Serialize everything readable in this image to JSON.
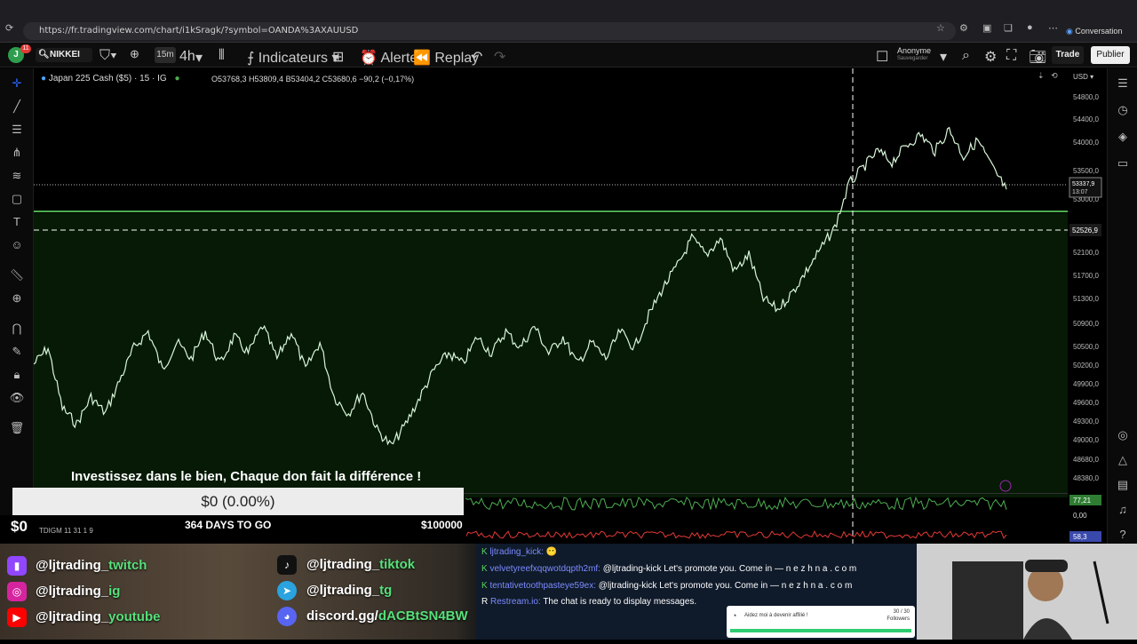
{
  "browser": {
    "url": "https://fr.tradingview.com/chart/i1kSragk/?symbol=OANDA%3AXAUUSD",
    "conversation_label": "Conversation"
  },
  "toolbar": {
    "avatar_letter": "J",
    "notif_count": "11",
    "symbol": "NIKKEI",
    "tf_15": "15m",
    "tf_4h": "4h",
    "indicators": "Indicateurs",
    "alert": "Alerte",
    "replay": "Replay",
    "account": "Anonyme",
    "save": "Sauvegarder",
    "trade": "Trade",
    "publish": "Publier"
  },
  "chart": {
    "legend": "Japan 225 Cash ($5) · 15 · IG",
    "ohlc": "O53768,3 H53809,4 B53404,2 C53680,6 −90,2 (−0,17%)",
    "currency": "USD",
    "price_labels": [
      "54800,0",
      "54400,0",
      "54000,0",
      "53500,0",
      "53000,0",
      "52100,0",
      "51700,0",
      "51300,0",
      "50900,0",
      "50500,0",
      "50200,0",
      "49900,0",
      "49600,0",
      "49300,0",
      "49000,0",
      "48680,0",
      "48380,0"
    ],
    "current_price": "53337,9",
    "countdown": "13:07",
    "crosshair_price": "52526,9",
    "osc_value": "77,21",
    "osc_zero": "0,00",
    "osc_value2": "58,3",
    "colors": {
      "accent": "#4caf50",
      "price_line": "#ffffff",
      "background": "#000000"
    }
  },
  "chart_data": {
    "type": "line",
    "title": "Japan 225 Cash ($5) · 15 · IG",
    "ylim": [
      48380,
      54800
    ],
    "y": [
      50200,
      50500,
      49400,
      49100,
      49600,
      49300,
      49900,
      50500,
      50800,
      50100,
      50600,
      50300,
      50800,
      50200,
      50700,
      50400,
      50900,
      50300,
      50800,
      50100,
      50600,
      49600,
      49300,
      49700,
      49000,
      48700,
      49100,
      49600,
      50100,
      50400,
      50200,
      50700,
      50400,
      50800,
      50500,
      50900,
      50400,
      50700,
      50200,
      50600,
      50300,
      50800,
      50500,
      51100,
      51600,
      52000,
      52500,
      52200,
      52500,
      51900,
      52200,
      51400,
      51200,
      51500,
      51900,
      52300,
      52700,
      53500,
      53800,
      54100,
      53900,
      54200,
      54400,
      54100,
      54500,
      54000,
      54300,
      53800,
      53400
    ]
  },
  "donation": {
    "title": "Investissez dans le bien, Chaque don fait la différence !",
    "percent": "$0 (0.00%)",
    "raised": "$0",
    "days": "364 DAYS TO GO",
    "goal": "$100000"
  },
  "indicator_legend": "TDIGM 11 31 1 9",
  "socials": [
    {
      "prefix": "@ljtrading_",
      "highlight": "twitch"
    },
    {
      "prefix": "@ljtrading_",
      "highlight": "ig"
    },
    {
      "prefix": "@ljtrading_",
      "highlight": "youtube"
    },
    {
      "prefix": "@ljtrading_",
      "highlight": "tiktok"
    },
    {
      "prefix": "@ljtrading_",
      "highlight": "tg"
    },
    {
      "prefix": "discord.gg/",
      "highlight": "dACBtSN4BW"
    }
  ],
  "chat": [
    {
      "user": "ljtrading_kick:",
      "msg": ""
    },
    {
      "user": "velvetyreefxqqwotdqpth2mf:",
      "msg": "@ljtrading-kick Let's promote you. Come in — n e z h n a . c o m"
    },
    {
      "user": "tentativetoothpasteye59ex:",
      "msg": "@ljtrading-kick Let's promote you. Come in — n e z h n a . c o m"
    },
    {
      "user": "Restream.io:",
      "msg": "The chat is ready to display messages."
    }
  ],
  "affiliate": {
    "text": "Aidez moi à devenir affilié !",
    "count": "30 / 30",
    "label": "Followers"
  }
}
